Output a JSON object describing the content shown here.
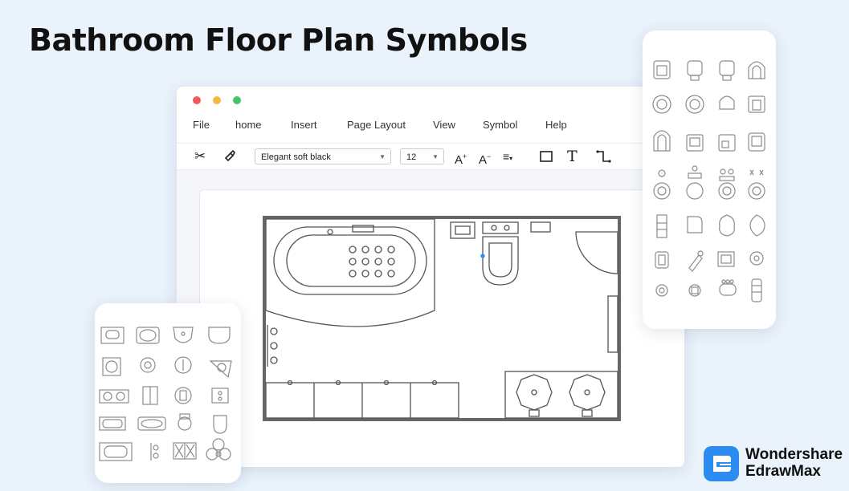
{
  "heading": "Bathroom Floor Plan Symbols",
  "menu": [
    "File",
    "home",
    "Insert",
    "Page Layout",
    "View",
    "Symbol",
    "Help"
  ],
  "toolbar": {
    "font_name": "Elegant soft black",
    "font_size": "12"
  },
  "brand": {
    "line1": "Wondershare",
    "line2": "EdrawMax"
  },
  "colors": {
    "dot_red": "#f05a5a",
    "dot_yellow": "#f5b942",
    "dot_green": "#45c46b",
    "brand_blue": "#2d8cf0"
  }
}
